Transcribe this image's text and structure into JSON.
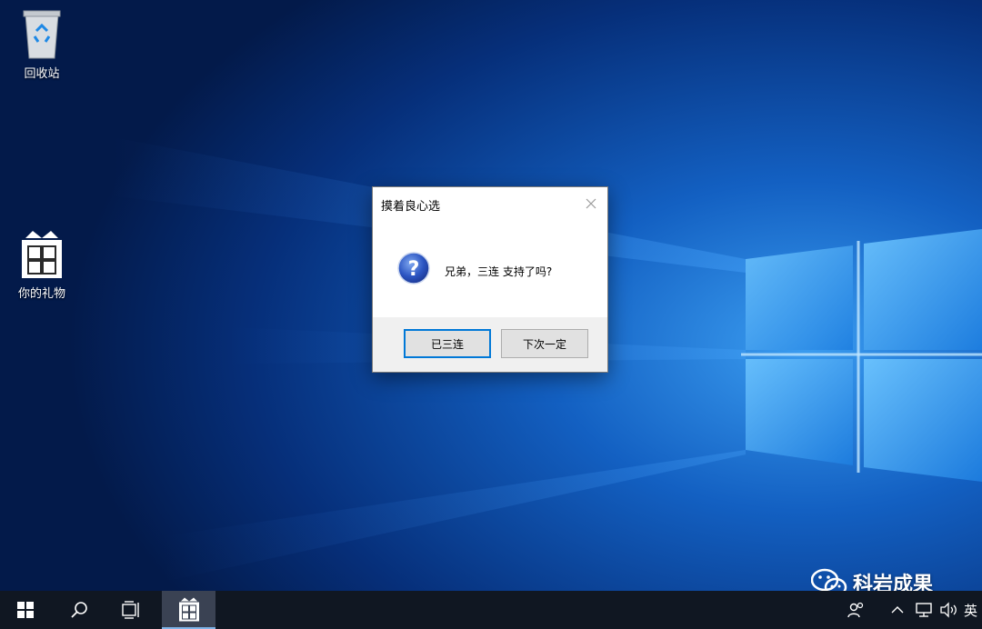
{
  "desktop": {
    "icons": [
      {
        "label": "回收站",
        "icon": "recycle-bin-icon"
      },
      {
        "label": "你的礼物",
        "icon": "gift-box-icon"
      }
    ]
  },
  "dialog": {
    "title": "摸着良心选",
    "close_icon": "close-icon",
    "message": "兄弟，三连 支持了吗?",
    "message_icon": "question-icon",
    "buttons": {
      "yes": "已三连",
      "no": "下次一定"
    }
  },
  "taskbar": {
    "start_icon": "windows-start-icon",
    "search_icon": "search-icon",
    "task_view_icon": "task-view-icon",
    "app_icon": "gift-box-icon",
    "tray": {
      "people_icon": "people-icon",
      "chevron_icon": "chevron-up-icon",
      "network_icon": "network-icon",
      "volume_icon": "volume-icon",
      "ime": "英"
    }
  },
  "watermark": {
    "icon": "wechat-icon",
    "text": "科岩成果"
  },
  "colors": {
    "wallpaper_dark": "#04215c",
    "wallpaper_light": "#2f8fe8",
    "taskbar": "#101722",
    "accent": "#0078d7"
  }
}
